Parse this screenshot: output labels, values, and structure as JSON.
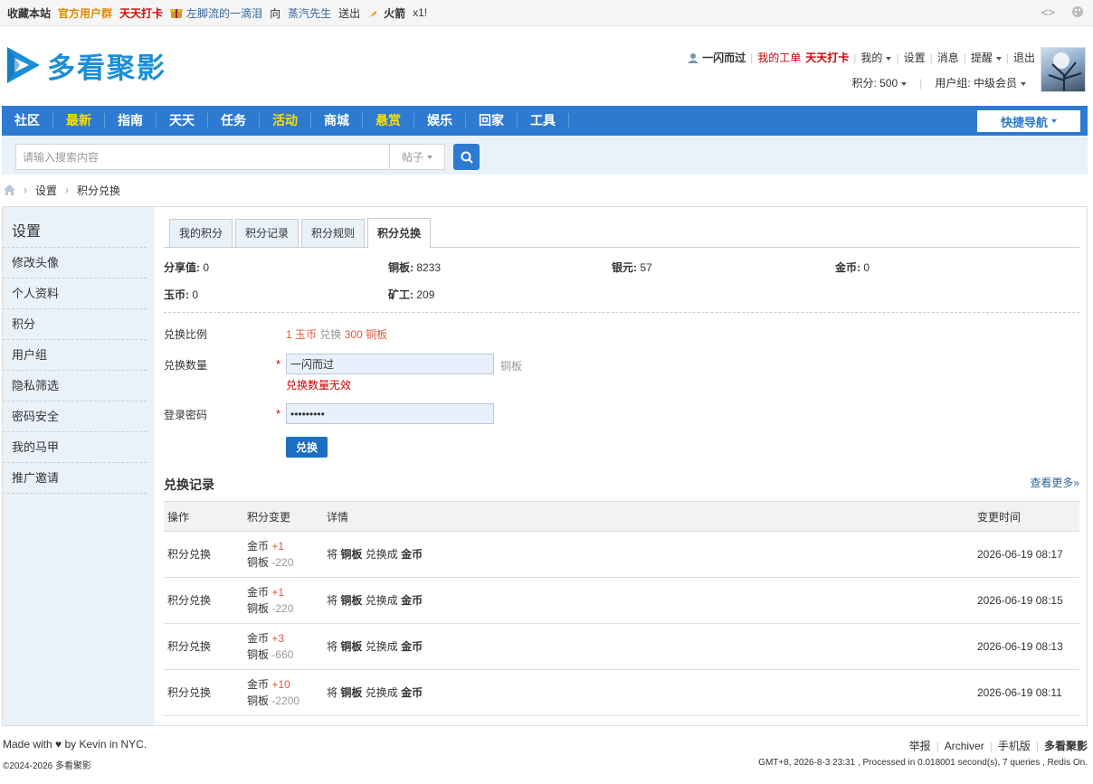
{
  "topbar": {
    "bookmark": "收藏本站",
    "group": "官方用户群",
    "checkin": "天天打卡",
    "sender": "左脚流的一滴泪",
    "to": "向",
    "receiver": "蒸汽先生",
    "sent": "送出",
    "gift": "火箭",
    "gift_count": "x1!"
  },
  "header": {
    "site_name": "多看聚影",
    "username": "一闪而过",
    "ticket": "我的工单",
    "checkin": "天天打卡",
    "mine": "我的",
    "settings": "设置",
    "messages": "消息",
    "remind": "提醒",
    "logout": "退出",
    "points_label": "积分: 500",
    "group_label": "用户组: 中级会员"
  },
  "nav": {
    "items": [
      {
        "label": "社区",
        "highlight": false
      },
      {
        "label": "最新",
        "highlight": true
      },
      {
        "label": "指南",
        "highlight": false
      },
      {
        "label": "天天",
        "highlight": false
      },
      {
        "label": "任务",
        "highlight": false
      },
      {
        "label": "活动",
        "highlight": true
      },
      {
        "label": "商城",
        "highlight": false
      },
      {
        "label": "悬赏",
        "highlight": true
      },
      {
        "label": "娱乐",
        "highlight": false
      },
      {
        "label": "回家",
        "highlight": false
      },
      {
        "label": "工具",
        "highlight": false
      }
    ],
    "quick_nav": "快捷导航"
  },
  "search": {
    "placeholder": "请输入搜索内容",
    "type": "帖子"
  },
  "breadcrumb": {
    "items": [
      "设置",
      "积分兑换"
    ]
  },
  "sidebar": {
    "title": "设置",
    "items": [
      "修改头像",
      "个人资料",
      "积分",
      "用户组",
      "隐私筛选",
      "密码安全",
      "我的马甲",
      "推广邀请"
    ]
  },
  "tabs": [
    "我的积分",
    "积分记录",
    "积分规则",
    "积分兑换"
  ],
  "credits": [
    {
      "label": "分享值:",
      "value": "0"
    },
    {
      "label": "铜板:",
      "value": "8233"
    },
    {
      "label": "银元:",
      "value": "57"
    },
    {
      "label": "金币:",
      "value": "0"
    },
    {
      "label": "玉币:",
      "value": "0"
    },
    {
      "label": "矿工:",
      "value": "209"
    }
  ],
  "form": {
    "ratio_label": "兑换比例",
    "ratio_a": "1 玉币",
    "ratio_mid": "兑换",
    "ratio_b": "300 铜板",
    "amount_label": "兑换数量",
    "required": "*",
    "amount_value": "一闪而过",
    "amount_unit": "铜板",
    "amount_error": "兑换数量无效",
    "password_label": "登录密码",
    "password_value": "123456789",
    "submit": "兑换"
  },
  "log": {
    "title": "兑换记录",
    "more": "查看更多»",
    "headers": [
      "操作",
      "积分变更",
      "详情",
      "变更时间"
    ],
    "rows": [
      {
        "op": "积分兑换",
        "c1": "金币",
        "v1": "+1",
        "c2": "铜板",
        "v2": "-220",
        "d_pre": "将",
        "d_from": "铜板",
        "d_mid": "兑换成",
        "d_to": "金币",
        "time": "2026-06-19 08:17"
      },
      {
        "op": "积分兑换",
        "c1": "金币",
        "v1": "+1",
        "c2": "铜板",
        "v2": "-220",
        "d_pre": "将",
        "d_from": "铜板",
        "d_mid": "兑换成",
        "d_to": "金币",
        "time": "2026-06-19 08:15"
      },
      {
        "op": "积分兑换",
        "c1": "金币",
        "v1": "+3",
        "c2": "铜板",
        "v2": "-660",
        "d_pre": "将",
        "d_from": "铜板",
        "d_mid": "兑换成",
        "d_to": "金币",
        "time": "2026-06-19 08:13"
      },
      {
        "op": "积分兑换",
        "c1": "金币",
        "v1": "+10",
        "c2": "铜板",
        "v2": "-2200",
        "d_pre": "将",
        "d_from": "铜板",
        "d_mid": "兑换成",
        "d_to": "金币",
        "time": "2026-06-19 08:11"
      }
    ]
  },
  "footer": {
    "made_with": "Made with ♥ by Kevin in NYC.",
    "copyright": "©2024-2026 多看聚影",
    "links": [
      "举报",
      "Archiver",
      "手机版",
      "多看聚影"
    ],
    "stats": "GMT+8, 2026-8-3 23:31 , Processed in 0.018001 second(s), 7 queries , Redis On."
  },
  "colors": {
    "nav_bg": "#2d7ad0",
    "nav_highlight": "#ffde00",
    "sidebar_bg": "#e9f1f9",
    "accent": "#1a6fc4",
    "error": "#c00000",
    "ratio": "#e05a3a"
  }
}
